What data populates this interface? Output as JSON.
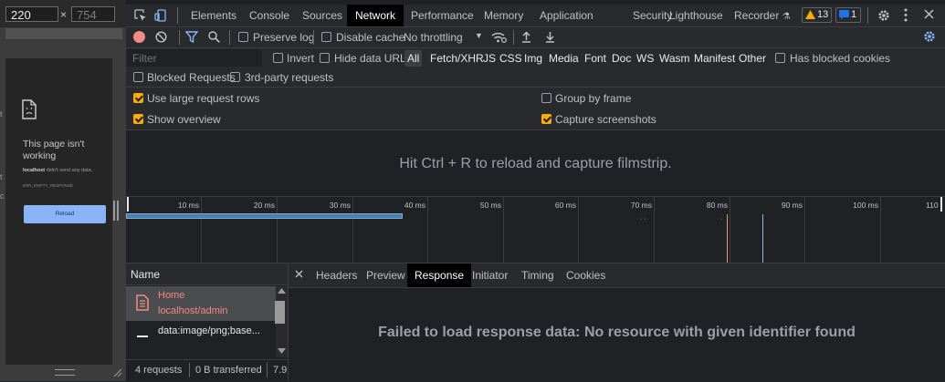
{
  "viewport": {
    "width": "220",
    "times": "×",
    "height": "754",
    "error_title": "This page isn't working",
    "error_host": "localhost",
    "error_detail": " didn't send any data.",
    "error_code": "ERR_EMPTY_RESPONSE",
    "reload_label": "Reload",
    "outer_text_1": "t",
    "outer_text_2": "t",
    "outer_text_3": "c"
  },
  "devtools_tabs": [
    "Elements",
    "Console",
    "Sources",
    "Network",
    "Performance",
    "Memory",
    "Application",
    "Security",
    "Lighthouse",
    "Recorder"
  ],
  "active_tab": "Network",
  "badges": {
    "warnings": "13",
    "issues": "1"
  },
  "toolbar": {
    "preserve_log": "Preserve log",
    "disable_cache": "Disable cache",
    "throttling": "No throttling"
  },
  "filter": {
    "placeholder": "Filter",
    "invert": "Invert",
    "hide_data_urls": "Hide data URLs",
    "types": [
      "All",
      "Fetch/XHR",
      "JS",
      "CSS",
      "Img",
      "Media",
      "Font",
      "Doc",
      "WS",
      "Wasm",
      "Manifest",
      "Other"
    ],
    "has_blocked_cookies": "Has blocked cookies",
    "blocked_requests": "Blocked Requests",
    "third_party": "3rd-party requests"
  },
  "settings": {
    "large_rows": "Use large request rows",
    "show_overview": "Show overview",
    "group_by_frame": "Group by frame",
    "capture_screenshots": "Capture screenshots"
  },
  "filmstrip_message": "Hit Ctrl + R to reload and capture filmstrip.",
  "overview_ticks": [
    "10 ms",
    "20 ms",
    "30 ms",
    "40 ms",
    "50 ms",
    "60 ms",
    "70 ms",
    "80 ms",
    "90 ms",
    "100 ms",
    "110"
  ],
  "requests": {
    "header": "Name",
    "items": [
      {
        "name": "Home",
        "path": "localhost/admin"
      },
      {
        "name": "data:image/png;base..."
      }
    ],
    "status": {
      "count": "4 requests",
      "transferred": "0 B transferred",
      "extra": "7.9"
    }
  },
  "detail_tabs": [
    "Headers",
    "Preview",
    "Response",
    "Initiator",
    "Timing",
    "Cookies"
  ],
  "active_detail_tab": "Response",
  "response_message": "Failed to load response data: No resource with given identifier found",
  "colors": {
    "accent": "#f9ab00",
    "active_tab_bg": "#000000",
    "error_red": "#f28b82",
    "blue": "#8ab4f8"
  }
}
